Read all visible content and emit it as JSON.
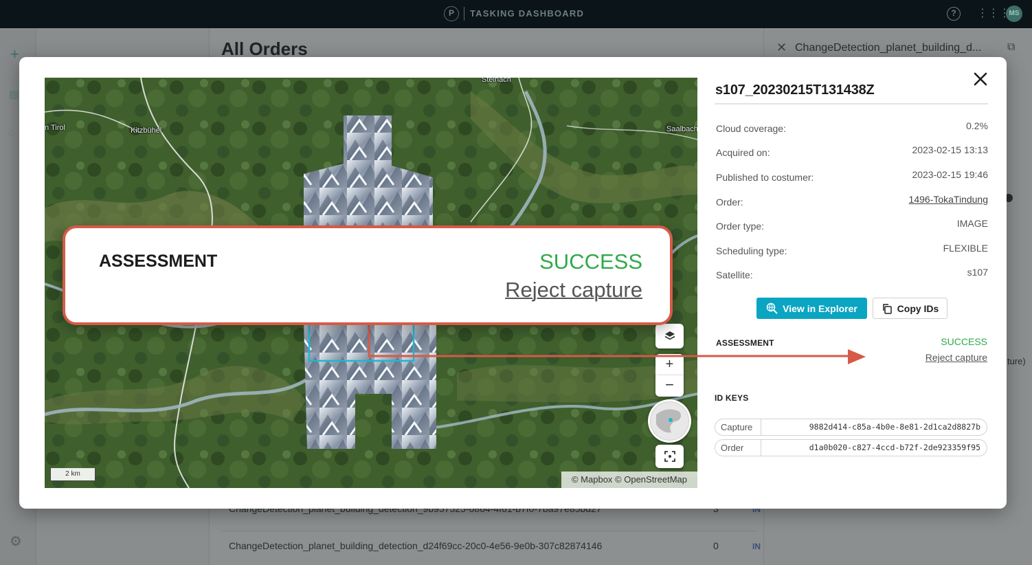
{
  "topbar": {
    "logo_letter": "P",
    "title": "TASKING DASHBOARD",
    "avatar_initials": "MS"
  },
  "background": {
    "main_title": "All Orders",
    "rows": [
      {
        "name": "ChangeDetection_planet_building_detection_9b957525-6864-4f61-b7f0-7ba97e85bd27",
        "count": "3",
        "status": "IN"
      },
      {
        "name": "ChangeDetection_planet_building_detection_d24f69cc-20c0-4e56-9e0b-307c82874146",
        "count": "0",
        "status": "IN"
      }
    ],
    "detail_title": "ChangeDetection_planet_building_d...",
    "peek_text": "ture)"
  },
  "map": {
    "labels": {
      "west": "n Tirol",
      "town": "Kitzbühel",
      "north": "Steinach",
      "east": "Saalbach"
    },
    "scale": "2 km",
    "attribution": "© Mapbox © OpenStreetMap"
  },
  "capture": {
    "title": "s107_20230215T131438Z",
    "properties": [
      {
        "label": "Cloud coverage:",
        "value": "0.2%",
        "link": false
      },
      {
        "label": "Acquired on:",
        "value": "2023-02-15 13:13",
        "link": false
      },
      {
        "label": "Published to costumer:",
        "value": "2023-02-15 19:46",
        "link": false
      },
      {
        "label": "Order:",
        "value": "1496-TokaTindung",
        "link": true
      },
      {
        "label": "Order type:",
        "value": "IMAGE",
        "link": false
      },
      {
        "label": "Scheduling type:",
        "value": "FLEXIBLE",
        "link": false
      },
      {
        "label": "Satellite:",
        "value": "s107",
        "link": false
      }
    ],
    "buttons": {
      "view_explorer": "View in Explorer",
      "copy_ids": "Copy IDs"
    },
    "assessment": {
      "label": "ASSESSMENT",
      "status": "SUCCESS",
      "reject": "Reject capture"
    },
    "id_keys": {
      "label": "ID KEYS",
      "rows": [
        {
          "key": "Capture",
          "value": "9882d414-c85a-4b0e-8e81-2d1ca2d8827b"
        },
        {
          "key": "Order",
          "value": "d1a0b020-c827-4ccd-b72f-2de923359f95"
        }
      ]
    }
  },
  "callout": {
    "label": "ASSESSMENT",
    "status": "SUCCESS",
    "reject": "Reject capture"
  },
  "colors": {
    "accent": "#0aa5c2",
    "success": "#2eaa4a",
    "highlight": "#d65a47"
  }
}
